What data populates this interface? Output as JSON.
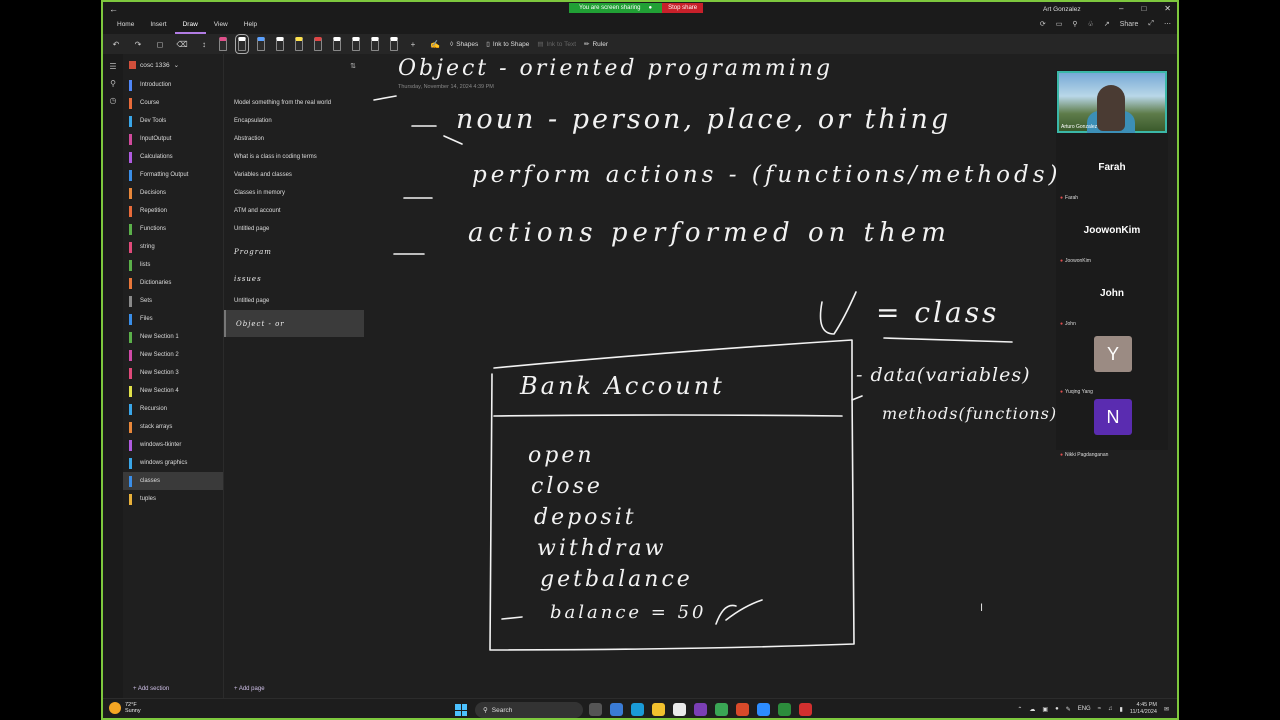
{
  "titlebar": {
    "share_status": "You are screen sharing",
    "stop_share": "Stop share",
    "user_name": "Art Gonzalez"
  },
  "menubar": {
    "tabs": [
      "Home",
      "Insert",
      "Draw",
      "View",
      "Help"
    ],
    "active_tab": "Draw",
    "share_label": "Share"
  },
  "toolbar": {
    "shapes_label": "Shapes",
    "ink_to_shape_label": "Ink to Shape",
    "ink_to_text_label": "Ink to Text",
    "ruler_label": "Ruler",
    "pen_colors": [
      "#e04f8a",
      "#ffffff",
      "#5aa0ff",
      "#ffffff",
      "#ffe34d",
      "#e04545",
      "#ffffff",
      "#ffffff",
      "#ffffff",
      "#ffffff"
    ]
  },
  "notebook": {
    "title": "cosc 1336",
    "sections": [
      {
        "label": "Introduction",
        "color": "#4f86f7"
      },
      {
        "label": "Course",
        "color": "#e86b3a"
      },
      {
        "label": "Dev Tools",
        "color": "#3aa6e8"
      },
      {
        "label": "InputOutput",
        "color": "#d04a9c"
      },
      {
        "label": "Calculations",
        "color": "#b05be0"
      },
      {
        "label": "Formatting Output",
        "color": "#3a8ee8"
      },
      {
        "label": "Decisions",
        "color": "#e8873a"
      },
      {
        "label": "Repetition",
        "color": "#e86b3a"
      },
      {
        "label": "Functions",
        "color": "#5bb04a"
      },
      {
        "label": "string",
        "color": "#e04a7a"
      },
      {
        "label": "lists",
        "color": "#5bb04a"
      },
      {
        "label": "Dictionaries",
        "color": "#e8773a"
      },
      {
        "label": "Sets",
        "color": "#8a8a8a"
      },
      {
        "label": "Files",
        "color": "#3a8ee8"
      },
      {
        "label": "New Section 1",
        "color": "#5bb04a"
      },
      {
        "label": "New Section 2",
        "color": "#d04aa8"
      },
      {
        "label": "New Section 3",
        "color": "#e04a7a"
      },
      {
        "label": "New Section 4",
        "color": "#e0e04a"
      },
      {
        "label": "Recursion",
        "color": "#3aa6e8"
      },
      {
        "label": "stack arrays",
        "color": "#e8873a"
      },
      {
        "label": "windows-tkinter",
        "color": "#b05be0"
      },
      {
        "label": "windows graphics",
        "color": "#3aa6e8"
      },
      {
        "label": "classes",
        "color": "#3a8ee8"
      },
      {
        "label": "tuples",
        "color": "#e8b03a"
      }
    ],
    "active_section": "classes",
    "add_section_label": "Add section"
  },
  "pages": {
    "items": [
      {
        "label": "Model something from the real world",
        "ink": false
      },
      {
        "label": "Encapsulation",
        "ink": false
      },
      {
        "label": "Abstraction",
        "ink": false
      },
      {
        "label": "What is a class in coding terms",
        "ink": false
      },
      {
        "label": "Variables and classes",
        "ink": false
      },
      {
        "label": "Classes in memory",
        "ink": false
      },
      {
        "label": "ATM and account",
        "ink": false
      },
      {
        "label": "Untitled page",
        "ink": false
      },
      {
        "label": "Program",
        "ink": true
      },
      {
        "label": "issues",
        "ink": true
      },
      {
        "label": "Untitled page",
        "ink": false
      },
      {
        "label": "Object - or",
        "ink": true
      }
    ],
    "active_index": 11,
    "add_page_label": "Add page"
  },
  "canvas": {
    "date_line": "Thursday, November 14, 2024     4:39 PM",
    "ink": {
      "title": "Object - oriented programming",
      "line1": "noun - person, place, or thing",
      "line2": "perform actions - (functions/methods)",
      "line3": "actions performed on them",
      "line4": "= class",
      "box_title": "Bank Account",
      "methods": [
        "open",
        "close",
        "deposit",
        "withdraw",
        "getbalance"
      ],
      "attribute": "balance = 50",
      "note1": "- data(variables)",
      "note2": "methods(functions)"
    }
  },
  "meeting": {
    "presenter": "Arturo Gonzalez",
    "participants": [
      {
        "name": "Farah",
        "small": "Farah"
      },
      {
        "name": "JoowonKim",
        "small": "JoowonKim"
      },
      {
        "name": "John",
        "small": "John"
      }
    ],
    "avatars": [
      {
        "letter": "Y",
        "small": "Yuqing Yang"
      },
      {
        "letter": "N",
        "small": "Nikki Pagdanganan"
      }
    ]
  },
  "taskbar": {
    "weather_temp": "72°F",
    "weather_desc": "Sunny",
    "search_placeholder": "Search",
    "lang": "ENG",
    "time": "4:45 PM",
    "date": "11/14/2024"
  }
}
